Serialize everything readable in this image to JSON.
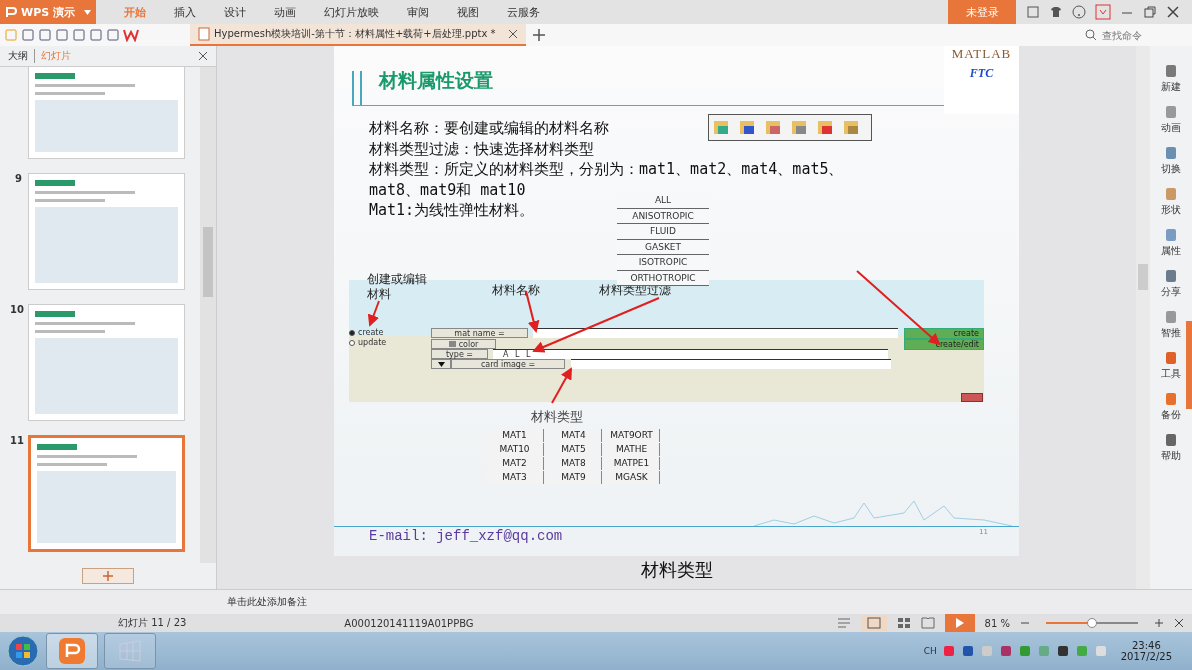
{
  "app_button": {
    "label": "WPS 演示"
  },
  "ribbon_tabs": [
    {
      "label": "开始",
      "selected": true
    },
    {
      "label": "插入",
      "selected": false
    },
    {
      "label": "设计",
      "selected": false
    },
    {
      "label": "动画",
      "selected": false
    },
    {
      "label": "幻灯片放映",
      "selected": false
    },
    {
      "label": "审阅",
      "selected": false
    },
    {
      "label": "视图",
      "selected": false
    },
    {
      "label": "云服务",
      "selected": false
    }
  ],
  "login_button": "未登录",
  "document_tab": {
    "title": "Hypermesh模块培训-第十节：材料属性+载荷+后处理.pptx *"
  },
  "search": {
    "placeholder": "查找命令"
  },
  "panel_tabs": [
    {
      "label": "大纲",
      "selected": false
    },
    {
      "label": "幻灯片",
      "selected": true
    }
  ],
  "thumbnails": [
    {
      "selected": false
    },
    {
      "number": "9",
      "selected": false
    },
    {
      "number": "10",
      "selected": false
    },
    {
      "number": "11",
      "selected": true
    }
  ],
  "slide": {
    "title": "材料属性设置",
    "logo": {
      "top": "MATLAB",
      "center": "FTC"
    },
    "lines": [
      "材料名称：要创建或编辑的材料名称",
      "材料类型过滤：快速选择材料类型",
      "材料类型：所定义的材料类型，分别为：mat1、mat2、mat4、mat5、",
      "mat8、mat9和 mat10",
      "Mat1:为线性弹性材料。"
    ],
    "type_options": [
      "ALL",
      "ANISOTROPIC",
      "FLUID",
      "GASKET",
      "ISOTROPIC",
      "ORTHOTROPIC"
    ],
    "callouts": [
      "创建或编辑材料",
      "材料名称",
      "材料类型过滤"
    ],
    "panel": {
      "radios": [
        {
          "label": "create",
          "selected": true
        },
        {
          "label": "update",
          "selected": false
        }
      ],
      "mat_name_button": "mat name =",
      "color_button": "color",
      "type_button": "type =",
      "type_value": "A L L",
      "card_button": "card image =",
      "actions": [
        "create",
        "create/edit"
      ]
    },
    "table_title": "材料类型",
    "table_rows": [
      [
        "MAT1",
        "MAT4",
        "MAT9ORT"
      ],
      [
        "MAT10",
        "MAT5",
        "MATHE"
      ],
      [
        "MAT2",
        "MAT8",
        "MATPE1"
      ],
      [
        "MAT3",
        "MAT9",
        "MGASK"
      ]
    ],
    "email": "E-mail: jeff_xzf@qq.com",
    "page_number": "11"
  },
  "caption": "材料类型",
  "notes_placeholder": "单击此处添加备注",
  "right_tools": [
    "新建",
    "动画",
    "切换",
    "形状",
    "属性",
    "分享",
    "智推",
    "工具",
    "备份",
    "帮助"
  ],
  "status": {
    "slide": "幻灯片 11 / 23",
    "template": "A000120141119A01PPBG",
    "zoom": "81 %",
    "zoom_slider": {
      "level": 0.5
    }
  },
  "taskbar": {
    "language": "CH",
    "time": "23:46",
    "date": "2017/2/25"
  }
}
